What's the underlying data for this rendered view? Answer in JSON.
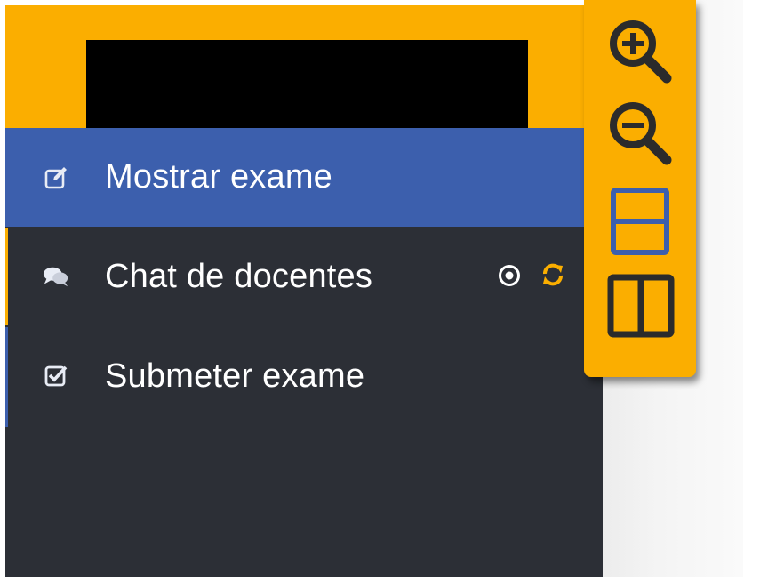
{
  "sidebar": {
    "menu": [
      {
        "label": "Mostrar exame",
        "icon": "edit-icon",
        "active": true
      },
      {
        "label": "Chat de docentes",
        "icon": "chat-icon",
        "active": false
      },
      {
        "label": "Submeter exame",
        "icon": "checkbox-icon",
        "active": false
      }
    ],
    "chat_actions": [
      {
        "icon": "target-circle-icon"
      },
      {
        "icon": "refresh-icon"
      }
    ]
  },
  "toolbar": {
    "buttons": [
      {
        "icon": "zoom-in-icon"
      },
      {
        "icon": "zoom-out-icon"
      },
      {
        "icon": "split-horizontal-icon"
      },
      {
        "icon": "split-vertical-icon"
      }
    ]
  },
  "colors": {
    "header": "#fbae00",
    "sidebar": "#2c2f36",
    "active_item": "#3c5fad",
    "accent": "#fbae00"
  }
}
